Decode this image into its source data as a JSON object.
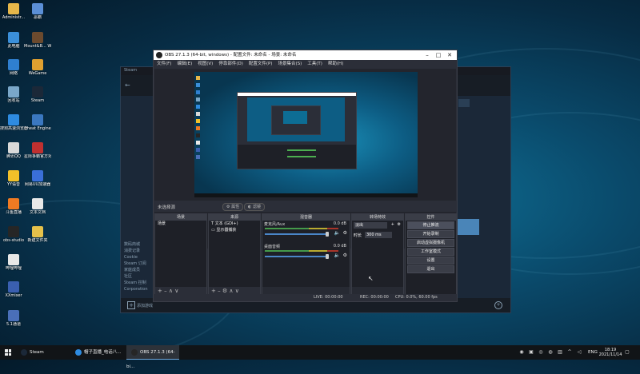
{
  "desktop": {
    "icons": [
      {
        "label": "Administr...",
        "color": "#e6b74a"
      },
      {
        "label": "恶霸",
        "color": "#5b8fd6"
      },
      {
        "label": "此电脑",
        "color": "#3b8fd9"
      },
      {
        "label": "Mount&B... Warband",
        "color": "#6b4a2e"
      },
      {
        "label": "网络",
        "color": "#2f7fd0"
      },
      {
        "label": "WeGame",
        "color": "#e0a030"
      },
      {
        "label": "回收站",
        "color": "#7aa7c9"
      },
      {
        "label": "Steam",
        "color": "#1b2838"
      },
      {
        "label": "搜狗高速浏览器",
        "color": "#2e8be0"
      },
      {
        "label": "Cheat Engine",
        "color": "#3b78c0"
      },
      {
        "label": "腾讯QQ",
        "color": "#d9d9d9"
      },
      {
        "label": "星际争霸官方对战平台",
        "color": "#c03030"
      },
      {
        "label": "YY语音",
        "color": "#f2c029"
      },
      {
        "label": "网易UU加速器",
        "color": "#3a6fd8"
      },
      {
        "label": "斗鱼直播",
        "color": "#f07a22"
      },
      {
        "label": "文本文档",
        "color": "#e8e8e8"
      },
      {
        "label": "obs-studio",
        "color": "#262626"
      },
      {
        "label": "新建文件夹",
        "color": "#e6c14a"
      },
      {
        "label": "哔哩哔哩",
        "color": "#e8e8e8"
      },
      {
        "label": "XXmixer",
        "color": "#3a5fb0"
      },
      {
        "label": "5.1通道",
        "color": "#4a6fb8"
      }
    ]
  },
  "steam": {
    "title": "Steam",
    "side_items": [
      "数码商城",
      "消费记录",
      "Cookie",
      "Steam 订阅",
      "家庭成员",
      "社区",
      "Steam 控制",
      "Corporation"
    ],
    "bottom_label": "添加游戏"
  },
  "obs": {
    "title": "OBS 27.1.3 (64-bit, windows) - 配置文件: 未命名 - 场景: 未命名",
    "menu": [
      "文件(F)",
      "编辑(E)",
      "视图(V)",
      "停靠部件(D)",
      "配置文件(P)",
      "场景集合(S)",
      "工具(T)",
      "帮助(H)"
    ],
    "scene_bar": {
      "label": "未选择源",
      "props": "属性",
      "filters": "滤镜"
    },
    "docks": {
      "scenes": {
        "header": "场景",
        "items": [
          "场景"
        ]
      },
      "sources": {
        "header": "来源",
        "items": [
          "文本 (GDI+)",
          "显示器捕获"
        ]
      },
      "mixer": {
        "header": "混音器",
        "items": [
          {
            "name": "麦克风/Aux",
            "db": "0.0 dB"
          },
          {
            "name": "桌面音频",
            "db": "0.0 dB"
          }
        ]
      },
      "transitions": {
        "header": "转场特效",
        "type": "淡出",
        "duration_label": "时长",
        "duration": "300 ms"
      },
      "controls": {
        "header": "控件",
        "buttons": [
          "停止推流",
          "开始录制",
          "启动虚拟摄像机",
          "工作室模式",
          "设置",
          "退出"
        ]
      }
    },
    "status": {
      "live": "LIVE: 00:00:00",
      "rec": "REC: 00:00:00",
      "cpu": "CPU: 0.0%, 60.00 fps"
    }
  },
  "taskbar": {
    "items": [
      {
        "label": "Steam",
        "color": "#1b2838"
      },
      {
        "label": "帽子直播_电话八...",
        "color": "#2e8be0"
      },
      {
        "label": "OBS 27.1.3 (64-bi...",
        "color": "#262626"
      }
    ],
    "lang": "ENG",
    "time": "18:19",
    "date": "2021/11/14"
  }
}
